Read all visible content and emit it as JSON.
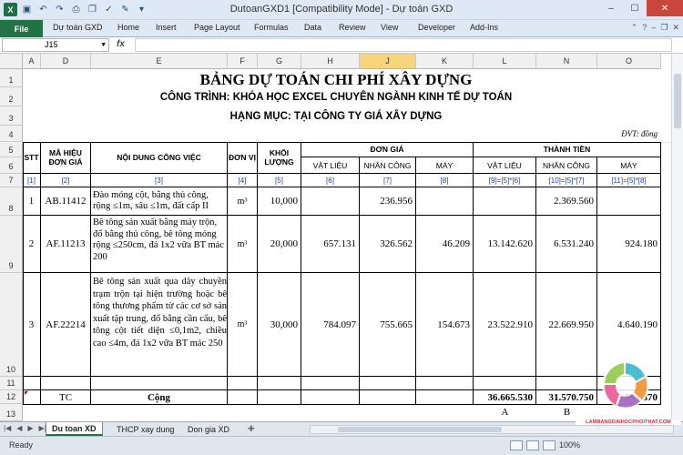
{
  "window": {
    "title": "DutoanGXD1  [Compatibility Mode]  -  Dự toán GXD",
    "minimize": "–",
    "maximize": "☐",
    "close": "✕"
  },
  "ribbon": {
    "file": "File",
    "tabs": [
      "Dự toán GXD",
      "Home",
      "Insert",
      "Page Layout",
      "Formulas",
      "Data",
      "Review",
      "View",
      "Developer",
      "Add-Ins"
    ]
  },
  "formula_bar": {
    "name_box": "J15",
    "fx": "fx",
    "value": ""
  },
  "columns": [
    "A",
    "D",
    "E",
    "F",
    "G",
    "H",
    "J",
    "K",
    "L",
    "N",
    "O"
  ],
  "rows": [
    "1",
    "2",
    "3",
    "4",
    "5",
    "6",
    "7",
    "8",
    "9",
    "10",
    "11",
    "12",
    "13"
  ],
  "sheet": {
    "title": "BẢNG DỰ TOÁN CHI PHÍ XÂY DỰNG",
    "project": "CÔNG TRÌNH: KHÓA HỌC EXCEL CHUYÊN NGÀNH KINH TẾ DỰ TOÁN",
    "category": "HẠNG MỤC: TẠI CÔNG TY GIÁ XÂY DỰNG",
    "unit_note": "ĐVT: đồng",
    "headers": {
      "stt": "STT",
      "code": "MÃ HIỆU ĐƠN GIÁ",
      "work": "NỘI DUNG CÔNG VIỆC",
      "unit": "ĐƠN VỊ",
      "qty": "KHỐI LƯỢNG",
      "unit_price": "ĐƠN GIÁ",
      "total": "THÀNH TIỀN",
      "material": "VẬT LIỆU",
      "labor": "NHÂN CÔNG",
      "machine": "MÁY"
    },
    "index_row": [
      "[1]",
      "[2]",
      "[3]",
      "[4]",
      "[5]",
      "[6]",
      "[7]",
      "[8]",
      "[9]=[5]*[6]",
      "[10]=[5]*[7]",
      "[11]=[5]*[8]"
    ],
    "items": [
      {
        "stt": "1",
        "code": "AB.11412",
        "work": "Đào móng cột, bằng thủ công, rộng ≤1m, sâu ≤1m, đất cấp II",
        "unit": "m³",
        "qty": "10,000",
        "material": "",
        "labor": "236.956",
        "machine": "",
        "t_material": "",
        "t_labor": "2.369.560",
        "t_machine": ""
      },
      {
        "stt": "2",
        "code": "AF.11213",
        "work": "Bê tông sản xuất bằng máy trộn, đổ bằng thủ công, bê tông móng rộng ≤250cm, đá 1x2 vữa BT mác 200",
        "unit": "m³",
        "qty": "20,000",
        "material": "657.131",
        "labor": "326.562",
        "machine": "46.209",
        "t_material": "13.142.620",
        "t_labor": "6.531.240",
        "t_machine": "924.180"
      },
      {
        "stt": "3",
        "code": "AF.22214",
        "work": "Bê tông sản xuất qua dây chuyền trạm trộn tại hiện trường hoặc bê tông thương phẩm từ các cơ sở sản xuất tập trung, đổ bằng cần cẩu, bê tông cột tiết diện ≤0,1m2, chiều cao ≤4m, đá 1x2 vữa BT mác 250",
        "unit": "m³",
        "qty": "30,000",
        "material": "784.097",
        "labor": "755.665",
        "machine": "154.673",
        "t_material": "23.522.910",
        "t_labor": "22.669.950",
        "t_machine": "4.640.190"
      }
    ],
    "total_row": {
      "code": "TC",
      "label": "Cộng",
      "material": "36.665.530",
      "labor": "31.570.750",
      "machine": "5.564.370"
    },
    "row13": {
      "material": "A",
      "labor": "B"
    }
  },
  "sheet_tabs": [
    "Du toan XD",
    "THCP xay dung",
    "Don gia XD"
  ],
  "status": {
    "ready": "Ready",
    "zoom": "100%"
  },
  "watermark": {
    "url": "LAMBANGDAIHOCPHOITHAT.COM"
  }
}
